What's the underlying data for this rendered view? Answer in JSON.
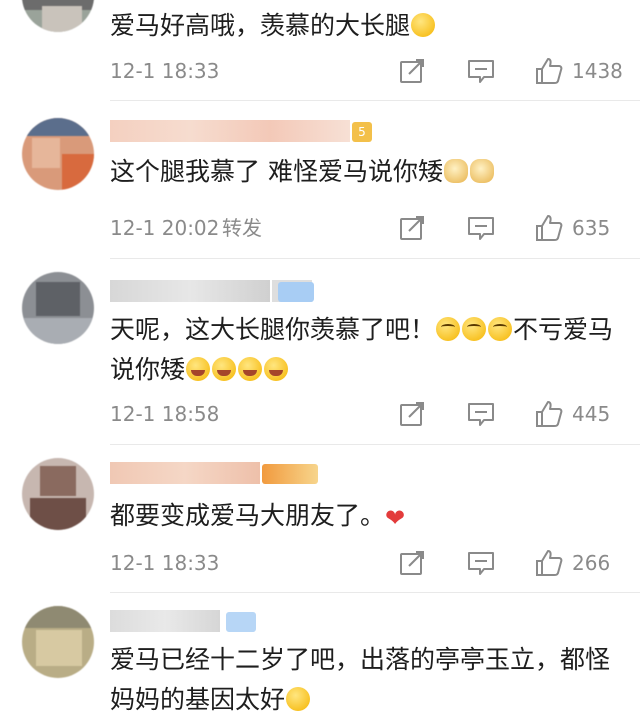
{
  "comments": [
    {
      "text": "爱马好高哦，羡慕的大长腿",
      "emojis_after": [
        "scream-emoji"
      ],
      "time": "12-1 18:33",
      "repost": "",
      "likes": "1438"
    },
    {
      "text": "这个腿我慕了 难怪爱马说你矮",
      "emojis_after": [
        "doge-emoji",
        "doge-emoji"
      ],
      "time": "12-1 20:02",
      "repost": "转发",
      "likes": "635"
    },
    {
      "text_a": "天呢，这大长腿你羡慕了吧！",
      "text_b": "不亏爱马说你矮",
      "emojis_mid": [
        "heart-eyes-emoji",
        "heart-eyes-emoji",
        "heart-eyes-emoji"
      ],
      "emojis_after": [
        "tears-of-joy-emoji",
        "tears-of-joy-emoji",
        "tears-of-joy-emoji",
        "tears-of-joy-emoji"
      ],
      "time": "12-1 18:58",
      "repost": "",
      "likes": "445"
    },
    {
      "text": "都要变成爱马大朋友了。",
      "emojis_after": [
        "heart-emoji"
      ],
      "time": "12-1 18:33",
      "repost": "",
      "likes": "266"
    },
    {
      "text": "爱马已经十二岁了吧，出落的亭亭玉立，都怪妈妈的基因太好",
      "emojis_after": [
        "tongue-emoji"
      ],
      "time": "",
      "repost": "",
      "likes": ""
    }
  ],
  "icons": {
    "share": "share-edit-icon",
    "comment": "comment-icon",
    "like": "thumbs-up-icon"
  },
  "colors": {
    "text": "#1e1e1e",
    "meta": "#8a8a8a",
    "divider": "#e9e9e9",
    "heart": "#e33b3b"
  }
}
